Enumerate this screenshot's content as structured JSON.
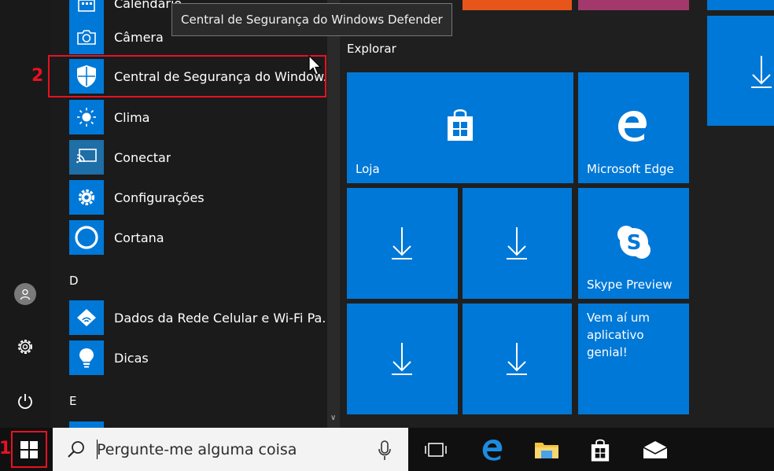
{
  "tooltip": {
    "text": "Central de Segurança do Windows Defender"
  },
  "steps": {
    "one": "1",
    "two": "2"
  },
  "applist": {
    "items": [
      {
        "label": "Calendário"
      },
      {
        "label": "Câmera"
      },
      {
        "label": "Central de Segurança do Window..."
      },
      {
        "label": "Clima"
      },
      {
        "label": "Conectar"
      },
      {
        "label": "Configurações"
      },
      {
        "label": "Cortana"
      },
      {
        "label": "Dados da Rede Celular e Wi-Fi Pa..."
      },
      {
        "label": "Dicas"
      }
    ],
    "headers": {
      "d": "D",
      "e": "E"
    }
  },
  "tiles": {
    "group_title": "Explorar",
    "loja": "Loja",
    "edge": "Microsoft Edge",
    "skype": "Skype Preview",
    "promo": "Vem aí um aplicativo genial!"
  },
  "taskbar": {
    "search_placeholder": "Pergunte-me alguma coisa"
  },
  "colors": {
    "accent": "#0078d7",
    "highlight": "#e81123",
    "menu_bg": "#1f1f1f"
  },
  "icons": {
    "rail": [
      "user-icon",
      "settings-gear-icon",
      "power-icon"
    ],
    "taskbar": [
      "windows-start-icon",
      "search-icon",
      "microphone-icon",
      "task-view-icon",
      "edge-icon",
      "file-explorer-icon",
      "store-icon",
      "mail-icon"
    ]
  }
}
